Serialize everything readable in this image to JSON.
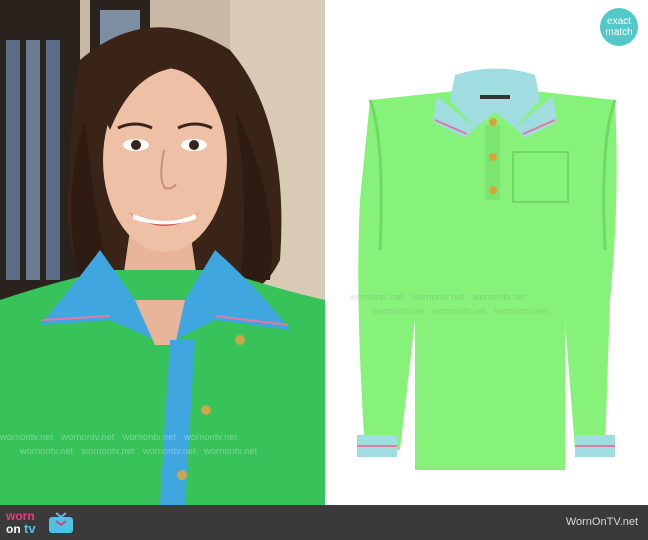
{
  "badge": {
    "line1": "exact",
    "line2": "match"
  },
  "watermark": {
    "text": "wornontv.net"
  },
  "footer": {
    "logo": {
      "word1": "worn",
      "word2": "on",
      "word3": "tv"
    },
    "site_name": "WornOnTV.net"
  },
  "colors": {
    "badge": "#53c8c8",
    "footer_bg": "#3a3a3a",
    "shirt_photo": "#37c25a",
    "shirt_product": "#86f27a",
    "collar_blue": "#3fa6e0",
    "collar_product": "#9fdde0",
    "logo_pink": "#e23f7e",
    "logo_blue": "#4fc3e6"
  },
  "images": {
    "left": "woman-wearing-green-polo-shirt-photo",
    "right": "green-polo-shirt-product-photo"
  },
  "icons": [
    "tv-icon"
  ]
}
